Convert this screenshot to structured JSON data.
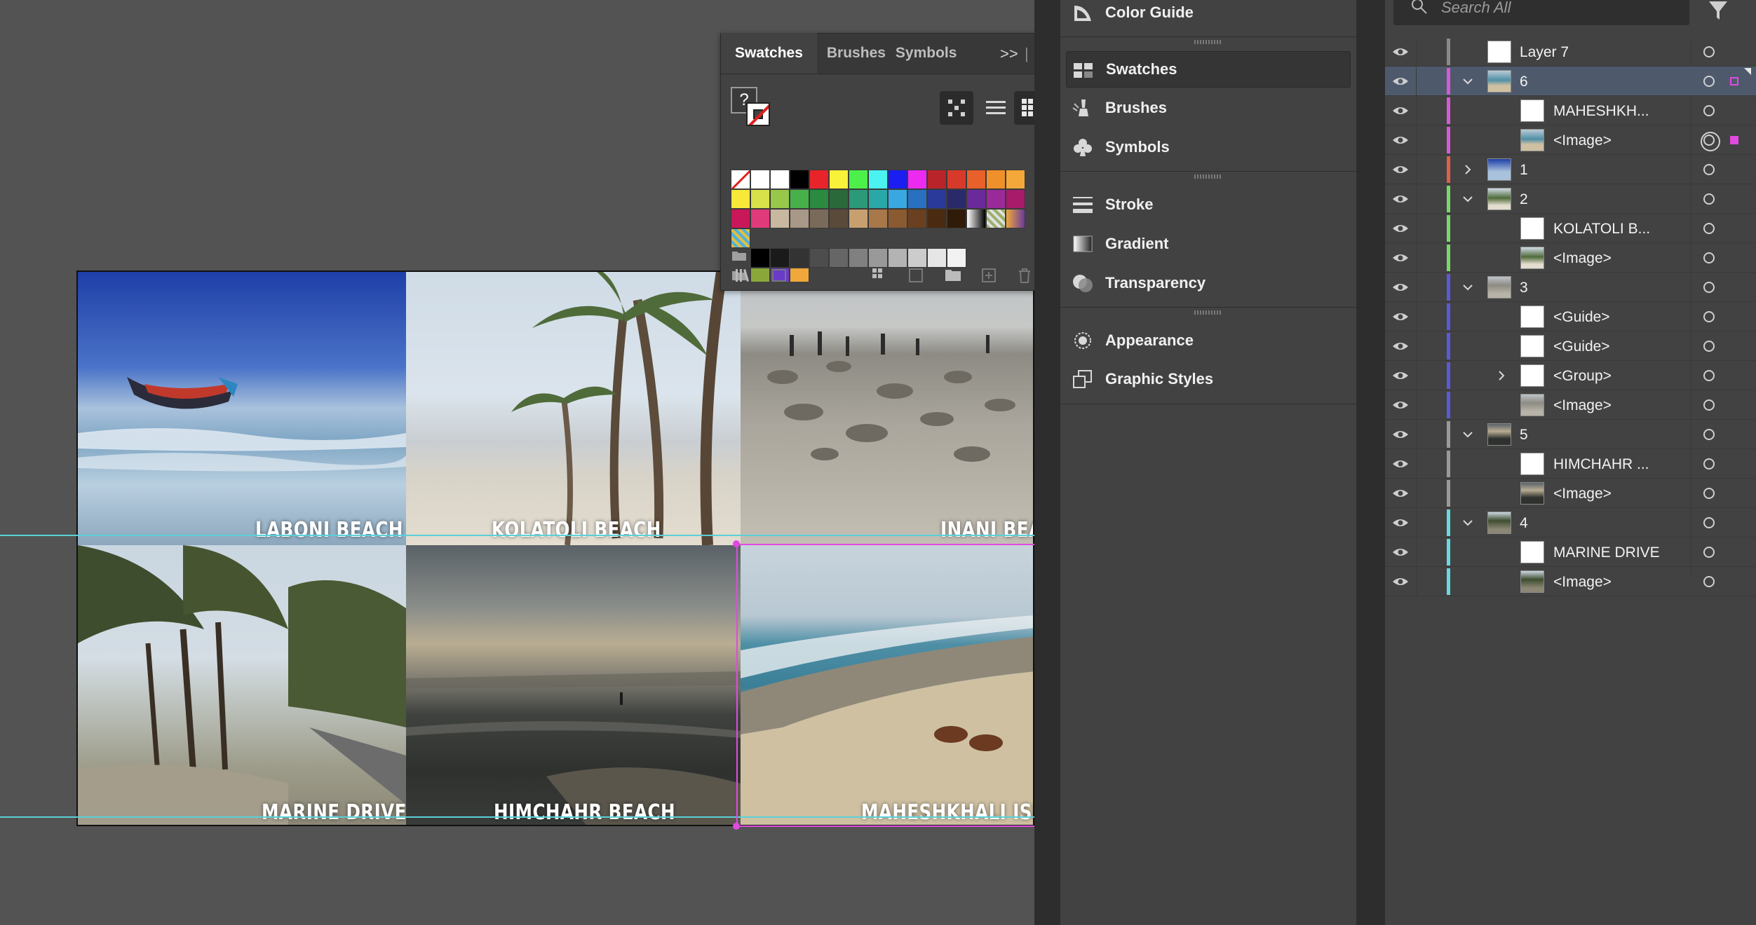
{
  "canvas": {
    "tiles": [
      {
        "caption": "LABONI BEACH"
      },
      {
        "caption": "KOLATOLI BEACH"
      },
      {
        "caption": "INANI BEAC"
      },
      {
        "caption": "MARINE DRIVE"
      },
      {
        "caption": "HIMCHAHR BEACH"
      },
      {
        "caption": "MAHESHKHALI ISLA"
      }
    ]
  },
  "swatches_panel": {
    "tabs": [
      "Swatches",
      "Brushes",
      "Symbols"
    ],
    "active_tab": "Swatches",
    "overflow": ">>",
    "none_glyph": "?"
  },
  "dock": {
    "items": [
      "Color Guide",
      "Swatches",
      "Brushes",
      "Symbols",
      "Stroke",
      "Gradient",
      "Transparency",
      "Appearance",
      "Graphic Styles"
    ],
    "active": "Swatches"
  },
  "layers": {
    "search_placeholder": "Search All",
    "rows": [
      {
        "name": "Layer 7"
      },
      {
        "name": "6"
      },
      {
        "name": "MAHESHKH..."
      },
      {
        "name": "<Image>"
      },
      {
        "name": "1"
      },
      {
        "name": "2"
      },
      {
        "name": "KOLATOLI B..."
      },
      {
        "name": "<Image>"
      },
      {
        "name": "3"
      },
      {
        "name": "<Guide>"
      },
      {
        "name": "<Guide>"
      },
      {
        "name": "<Group>"
      },
      {
        "name": "<Image>"
      },
      {
        "name": "5"
      },
      {
        "name": "HIMCHAHR ..."
      },
      {
        "name": "<Image>"
      },
      {
        "name": "4"
      },
      {
        "name": "MARINE DRIVE"
      },
      {
        "name": "<Image>"
      }
    ]
  },
  "colors": {
    "guide": "#5ad0d8",
    "selection": "#e04ae0",
    "layer_6": "#d55ad5",
    "layer_1": "#e0604a",
    "layer_2": "#7ad86a",
    "layer_3": "#5a5ad8",
    "layer_5": "#9a9a9a",
    "layer_4": "#6ad8e0"
  }
}
